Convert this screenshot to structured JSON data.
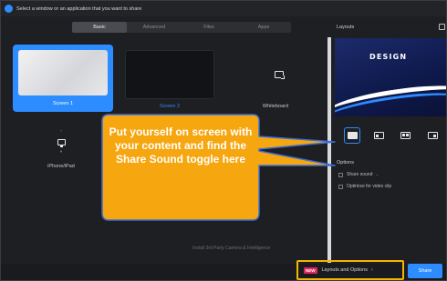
{
  "window": {
    "title": "Select a window or an application that you want to share"
  },
  "tabs": [
    {
      "label": "Basic",
      "active": true
    },
    {
      "label": "Advanced",
      "active": false
    },
    {
      "label": "Files",
      "active": false
    },
    {
      "label": "Apps",
      "active": false
    }
  ],
  "tiles": {
    "screen1": "Screen 1",
    "screen2": "Screen 2",
    "whiteboard": "Whiteboard",
    "phone": "iPhone/iPad"
  },
  "footnote": "Install 3rd Party Camera & Intelligence",
  "layouts_panel": {
    "title": "Layouts",
    "preview_text": "DESIGN",
    "options_label": "Options",
    "share_sound": "Share sound",
    "optimize": "Optimize for video clip"
  },
  "callout": {
    "text": "Put yourself on screen with your content and find the Share Sound toggle here",
    "color": "#f6a60f"
  },
  "bottom": {
    "new_badge": "NEW",
    "layouts_button": "Layouts and Options",
    "share_button": "Share"
  },
  "colors": {
    "accent": "#2d8cff",
    "highlight": "#f6b400"
  }
}
